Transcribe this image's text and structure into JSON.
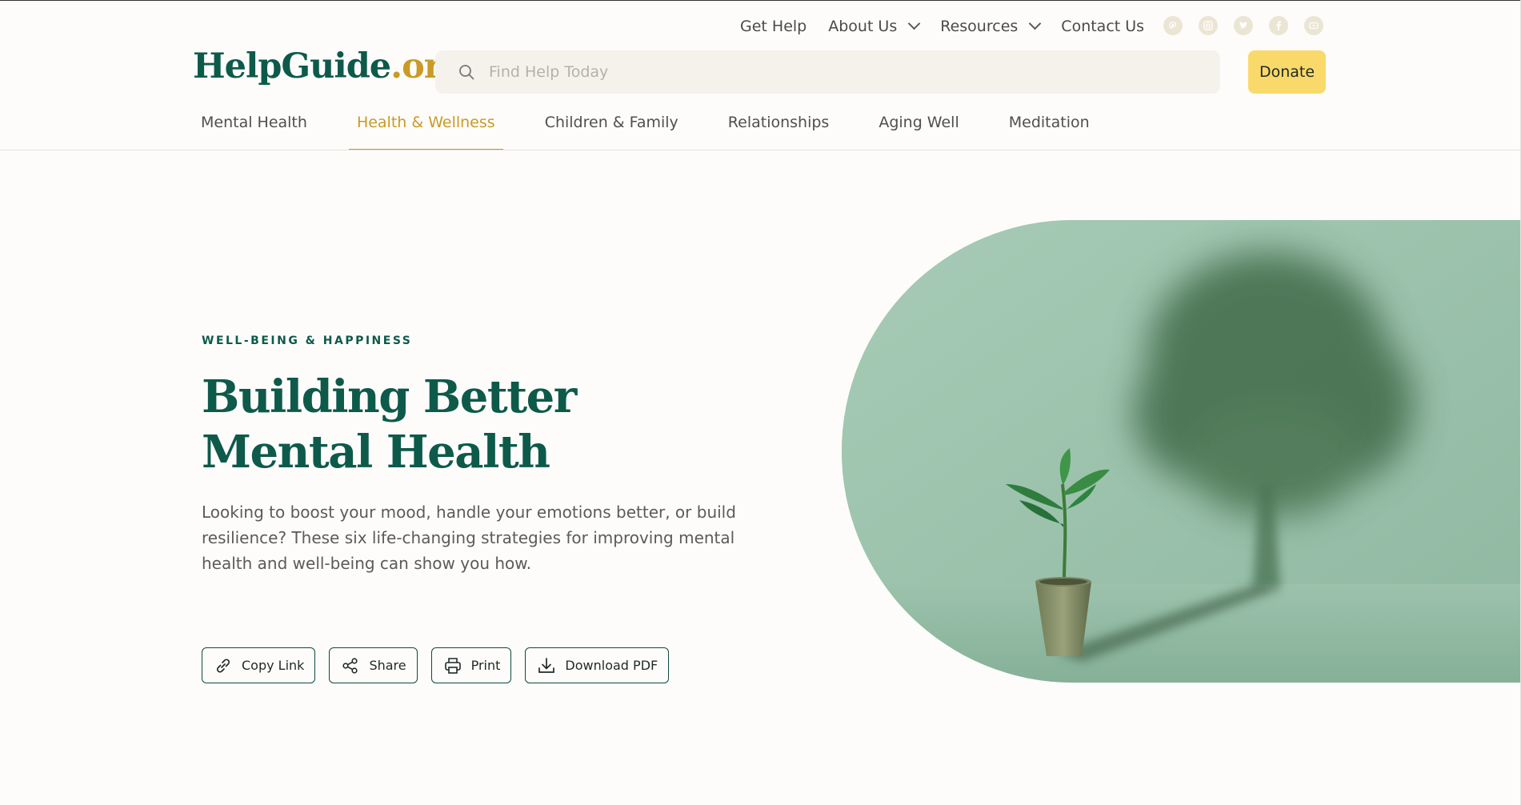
{
  "utility_nav": {
    "get_help": "Get Help",
    "about_us": "About Us",
    "resources": "Resources",
    "contact_us": "Contact Us"
  },
  "social_icons": [
    "pinterest-icon",
    "instagram-icon",
    "twitter-icon",
    "facebook-icon",
    "youtube-icon"
  ],
  "logo": {
    "name": "HelpGuide",
    "tld": ".org"
  },
  "search": {
    "placeholder": "Find Help Today",
    "value": ""
  },
  "donate_label": "Donate",
  "main_nav": {
    "items": [
      {
        "label": "Mental Health",
        "active": false
      },
      {
        "label": "Health & Wellness",
        "active": true
      },
      {
        "label": "Children & Family",
        "active": false
      },
      {
        "label": "Relationships",
        "active": false
      },
      {
        "label": "Aging Well",
        "active": false
      },
      {
        "label": "Meditation",
        "active": false
      }
    ]
  },
  "hero": {
    "eyebrow": "WELL-BEING & HAPPINESS",
    "title": "Building Better Mental Health",
    "description": "Looking to boost your mood, handle your emotions better, or build resilience? These six life-changing strategies for improving mental health and well-being can show you how."
  },
  "actions": {
    "copy_link": "Copy Link",
    "share": "Share",
    "print": "Print",
    "download_pdf": "Download PDF"
  },
  "colors": {
    "brand_green": "#0d5a4a",
    "brand_gold": "#c99a25",
    "donate_yellow": "#f9d96a",
    "background": "#fdfcfa"
  }
}
